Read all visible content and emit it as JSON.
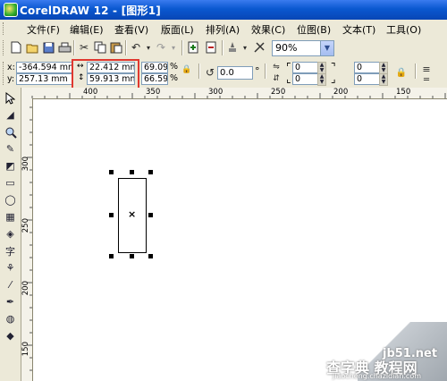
{
  "window": {
    "title": "CorelDRAW 12 - [图形1]"
  },
  "menu": [
    {
      "label": "文件(F)"
    },
    {
      "label": "编辑(E)"
    },
    {
      "label": "查看(V)"
    },
    {
      "label": "版面(L)"
    },
    {
      "label": "排列(A)"
    },
    {
      "label": "效果(C)"
    },
    {
      "label": "位图(B)"
    },
    {
      "label": "文本(T)"
    },
    {
      "label": "工具(O)"
    }
  ],
  "toolbar": {
    "zoom": "90%"
  },
  "property_bar": {
    "x": "-364.594 mm",
    "y": "257.13 mm",
    "width": "22.412 mm",
    "height": "59.913 mm",
    "scale_x": "69.09",
    "scale_y": "66.59",
    "percent_x": "%",
    "percent_y": "%",
    "rotation": "0.0",
    "degree": "°",
    "corner_tl": "0",
    "corner_tr": "0",
    "corner_bl": "0",
    "corner_br": "0"
  },
  "ruler": {
    "horizontal": [
      "400",
      "350",
      "300",
      "250",
      "200",
      "150"
    ],
    "vertical": [
      "300",
      "250",
      "200",
      "150"
    ]
  },
  "watermark": {
    "site": "jb51.net",
    "text": "查字典 教程网",
    "url": "jiaocheng.chazidian.com"
  },
  "colors": {
    "titlebar": "#0a58d0",
    "highlight": "#e0382f",
    "canvas": "#ffffff"
  },
  "icons": [
    "new-icon",
    "open-icon",
    "save-icon",
    "print-icon",
    "cut-icon",
    "copy-icon",
    "paste-icon",
    "undo-icon",
    "redo-icon",
    "import-icon",
    "export-icon",
    "launcher-icon",
    "app-icon"
  ]
}
